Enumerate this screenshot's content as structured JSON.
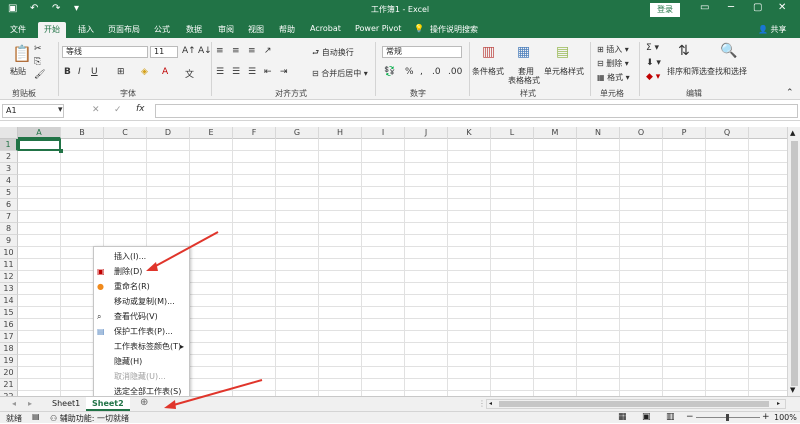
{
  "window": {
    "title": "工作簿1 - Excel",
    "login": "登录",
    "share": "共享"
  },
  "tabs": [
    "文件",
    "开始",
    "插入",
    "页面布局",
    "公式",
    "数据",
    "审阅",
    "视图",
    "帮助",
    "Acrobat",
    "Power Pivot"
  ],
  "tell_me": "操作说明搜索",
  "ribbon": {
    "clipboard": {
      "paste": "粘贴",
      "label": "剪贴板"
    },
    "font": {
      "name": "等线",
      "size": "11",
      "label": "字体"
    },
    "alignment": {
      "wrap": "自动换行",
      "merge": "合并后居中",
      "label": "对齐方式"
    },
    "number": {
      "format": "常规",
      "label": "数字"
    },
    "styles": {
      "conditional": "条件格式",
      "table": "套用",
      "table2": "表格格式",
      "cell_styles": "单元格样式",
      "label": "样式"
    },
    "cells": {
      "insert": "插入",
      "delete": "删除",
      "format": "格式",
      "label": "单元格"
    },
    "editing": {
      "sort": "排序和筛选",
      "find": "查找和选择",
      "label": "编辑"
    }
  },
  "namebox": "A1",
  "fx": "fx",
  "columns": [
    "A",
    "B",
    "C",
    "D",
    "E",
    "F",
    "G",
    "H",
    "I",
    "J",
    "K",
    "L",
    "M",
    "N",
    "O",
    "P",
    "Q"
  ],
  "rows": [
    "1",
    "2",
    "3",
    "4",
    "5",
    "6",
    "7",
    "8",
    "9",
    "10",
    "11",
    "12",
    "13",
    "14",
    "15",
    "16",
    "17",
    "18",
    "19",
    "20",
    "21",
    "22"
  ],
  "context_menu": [
    {
      "label": "插入(I)...",
      "disabled": false
    },
    {
      "label": "删除(D)",
      "disabled": false
    },
    {
      "label": "重命名(R)",
      "disabled": false
    },
    {
      "label": "移动或复制(M)...",
      "disabled": false
    },
    {
      "label": "查看代码(V)",
      "disabled": false
    },
    {
      "label": "保护工作表(P)...",
      "disabled": false
    },
    {
      "label": "工作表标签颜色(T)",
      "disabled": false
    },
    {
      "label": "隐藏(H)",
      "disabled": false
    },
    {
      "label": "取消隐藏(U)...",
      "disabled": true
    },
    {
      "label": "选定全部工作表(S)",
      "disabled": false
    }
  ],
  "sheets": [
    "Sheet1",
    "Sheet2"
  ],
  "status": {
    "ready": "就绪",
    "accessibility": "辅助功能: 一切就绪",
    "zoom": "100%"
  },
  "colors": {
    "brand": "#217346",
    "arrow": "#e0352b"
  }
}
